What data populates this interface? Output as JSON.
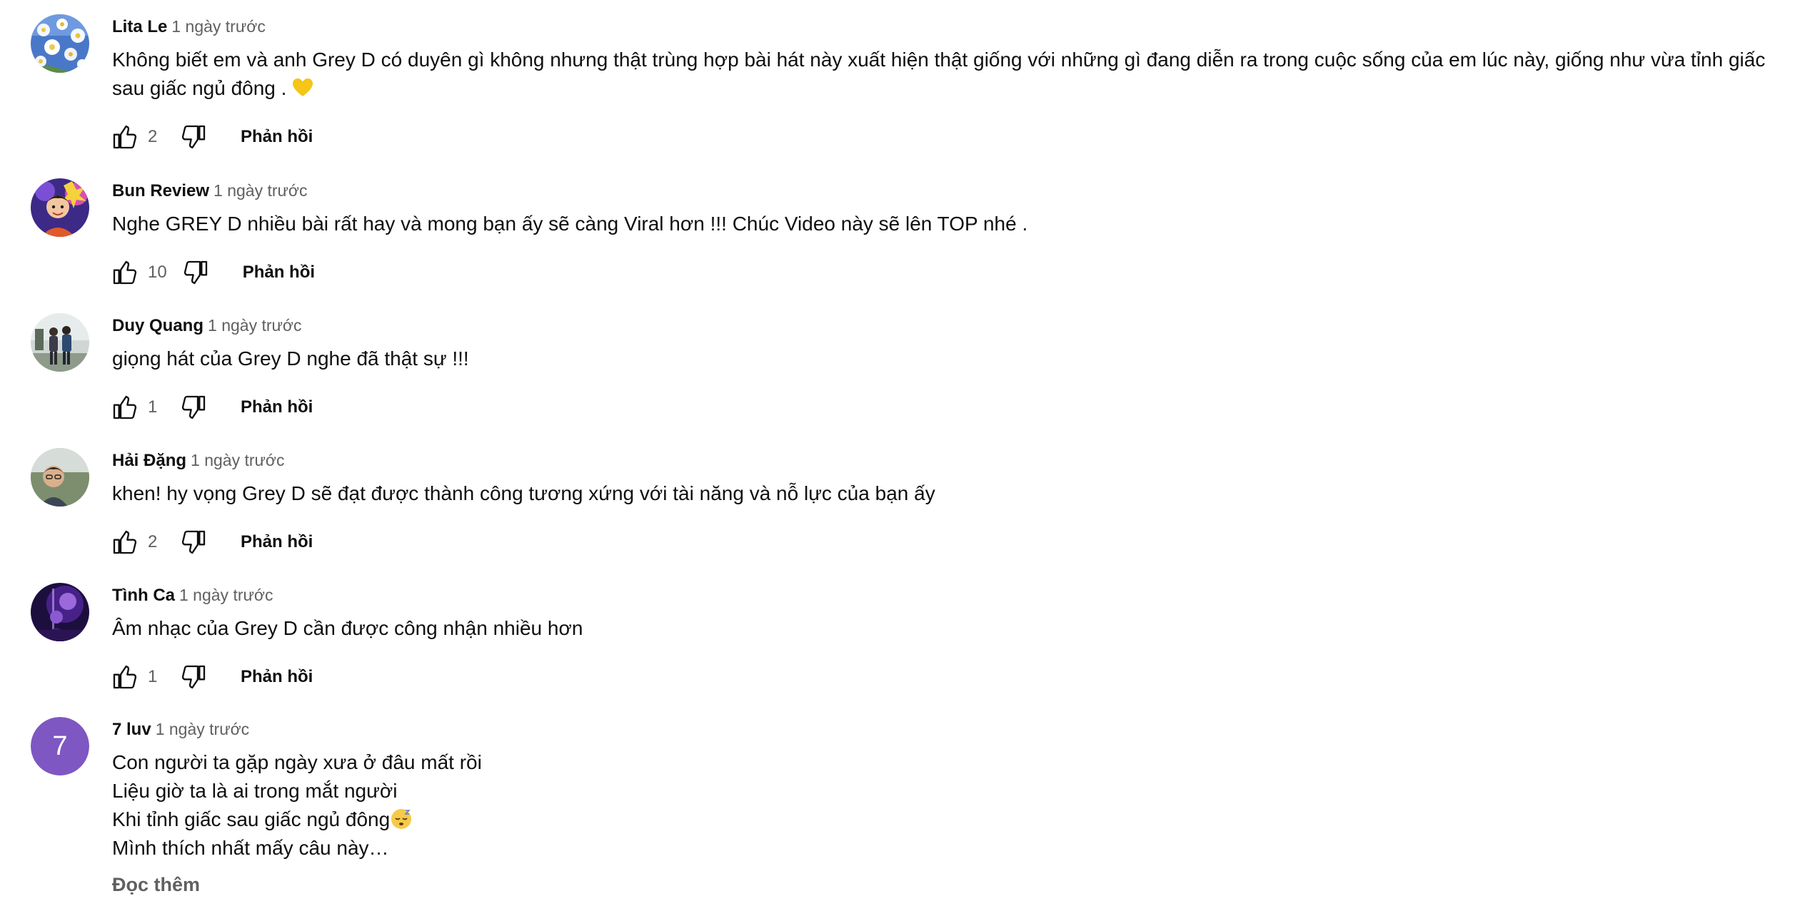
{
  "comments": [
    {
      "author": "Lita Le",
      "time": "1 ngày trước",
      "text": "Không biết em và anh Grey D có duyên gì không nhưng thật trùng hợp bài hát này xuất hiện thật giống với những gì đang diễn ra trong cuộc sống của em lúc này, giống như vừa tỉnh giấc sau giấc ngủ đông .",
      "emoji": "yellow-heart",
      "likes": "2",
      "reply_label": "Phản hồi",
      "avatar": "flowers-photo"
    },
    {
      "author": "Bun Review",
      "time": "1 ngày trước",
      "text": "Nghe GREY D nhiều bài rất hay và mong bạn ấy sẽ càng Viral hơn !!! Chúc Video này sẽ lên TOP nhé .",
      "likes": "10",
      "reply_label": "Phản hồi",
      "avatar": "cartoon-photo"
    },
    {
      "author": "Duy Quang",
      "time": "1 ngày trước",
      "text": "giọng hát của Grey D nghe đã thật sự !!!",
      "likes": "1",
      "reply_label": "Phản hồi",
      "avatar": "couple-photo"
    },
    {
      "author": "Hải Đặng",
      "time": "1 ngày trước",
      "text": "khen! hy vọng Grey D sẽ đạt được thành công tương xứng với tài năng và nỗ lực của bạn ấy",
      "likes": "2",
      "reply_label": "Phản hồi",
      "avatar": "portrait-photo"
    },
    {
      "author": "Tình Ca",
      "time": "1 ngày trước",
      "text": "Âm nhạc của Grey D cần được công nhận nhiều hơn",
      "likes": "1",
      "reply_label": "Phản hồi",
      "avatar": "purple-stage-photo"
    },
    {
      "author": "7 luv",
      "time": "1 ngày trước",
      "avatar_letter": "7",
      "avatar_color": "#7e57c2",
      "lines": [
        "Con người ta gặp ngày xưa ở đâu mất rồi",
        "Liệu giờ ta là ai trong mắt người",
        "Khi tỉnh giấc sau giấc ngủ đông",
        "Mình thích nhất mấy câu này…"
      ],
      "emoji": "sleeping-face",
      "read_more": "Đọc thêm"
    }
  ],
  "colors": {
    "text_primary": "#0f0f0f",
    "text_secondary": "#606060",
    "background": "#ffffff"
  }
}
